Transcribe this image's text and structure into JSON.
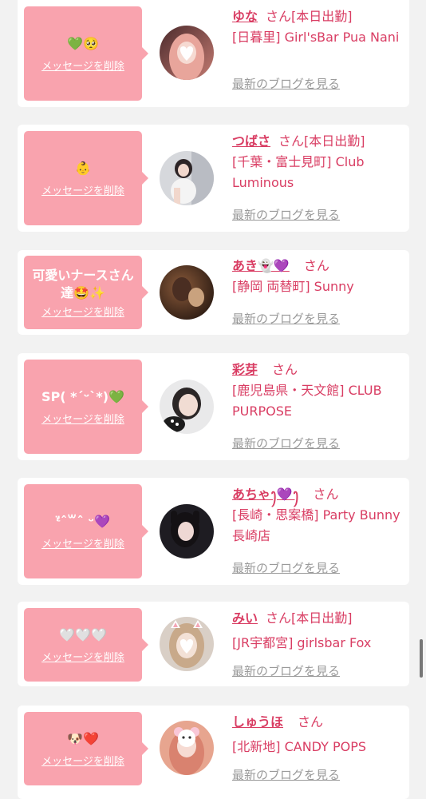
{
  "cards": [
    {
      "message": "💚🥺",
      "delete_label": "メッセージを削除",
      "name": "ゆな",
      "suffix": "さん[本日出勤]",
      "shop": "[日暮里] Girl'sBar Pua Nani",
      "blog_label": "最新のブログを見る"
    },
    {
      "message": "👶",
      "delete_label": "メッセージを削除",
      "name": "つばさ",
      "suffix": "さん[本日出勤]",
      "shop": "[千葉・富士見町] Club Luminous",
      "blog_label": "最新のブログを見る"
    },
    {
      "message": "可愛いナースさん達🤩✨",
      "delete_label": "メッセージを削除",
      "name": "あき👻💜",
      "suffix": "さん",
      "shop": "[静岡 両替町] Sunny",
      "blog_label": "最新のブログを見る"
    },
    {
      "message": "SP( *ˊᵕˋ*)💚",
      "delete_label": "メッセージを削除",
      "name": "彩芽",
      "suffix": "さん",
      "shop": "[鹿児島県・天文館] CLUB PURPOSE",
      "blog_label": "最新のブログを見る"
    },
    {
      "message": "ᵋ̈ˆ꒳ˆ ᵕ💜",
      "delete_label": "メッセージを削除",
      "name": "あちゃꫂ💜ꫂ",
      "suffix": "さん",
      "shop": "[長崎・思案橋] Party Bunny 長崎店",
      "blog_label": "最新のブログを見る"
    },
    {
      "message": "🤍🤍🤍",
      "delete_label": "メッセージを削除",
      "name": "みい",
      "suffix": "さん[本日出勤]",
      "shop": "[JR宇都宮] girlsbar Fox",
      "blog_label": "最新のブログを見る"
    },
    {
      "message": "🐶❤️",
      "delete_label": "メッセージを削除",
      "name": "しゅうほ",
      "suffix": "さん",
      "shop": "[北新地] CANDY POPS",
      "blog_label": "最新のブログを見る"
    }
  ],
  "colors": {
    "accent": "#d93d63",
    "bubble": "#f9a3ae",
    "background": "#f2f2f2",
    "link_gray": "#9a9a9a"
  }
}
